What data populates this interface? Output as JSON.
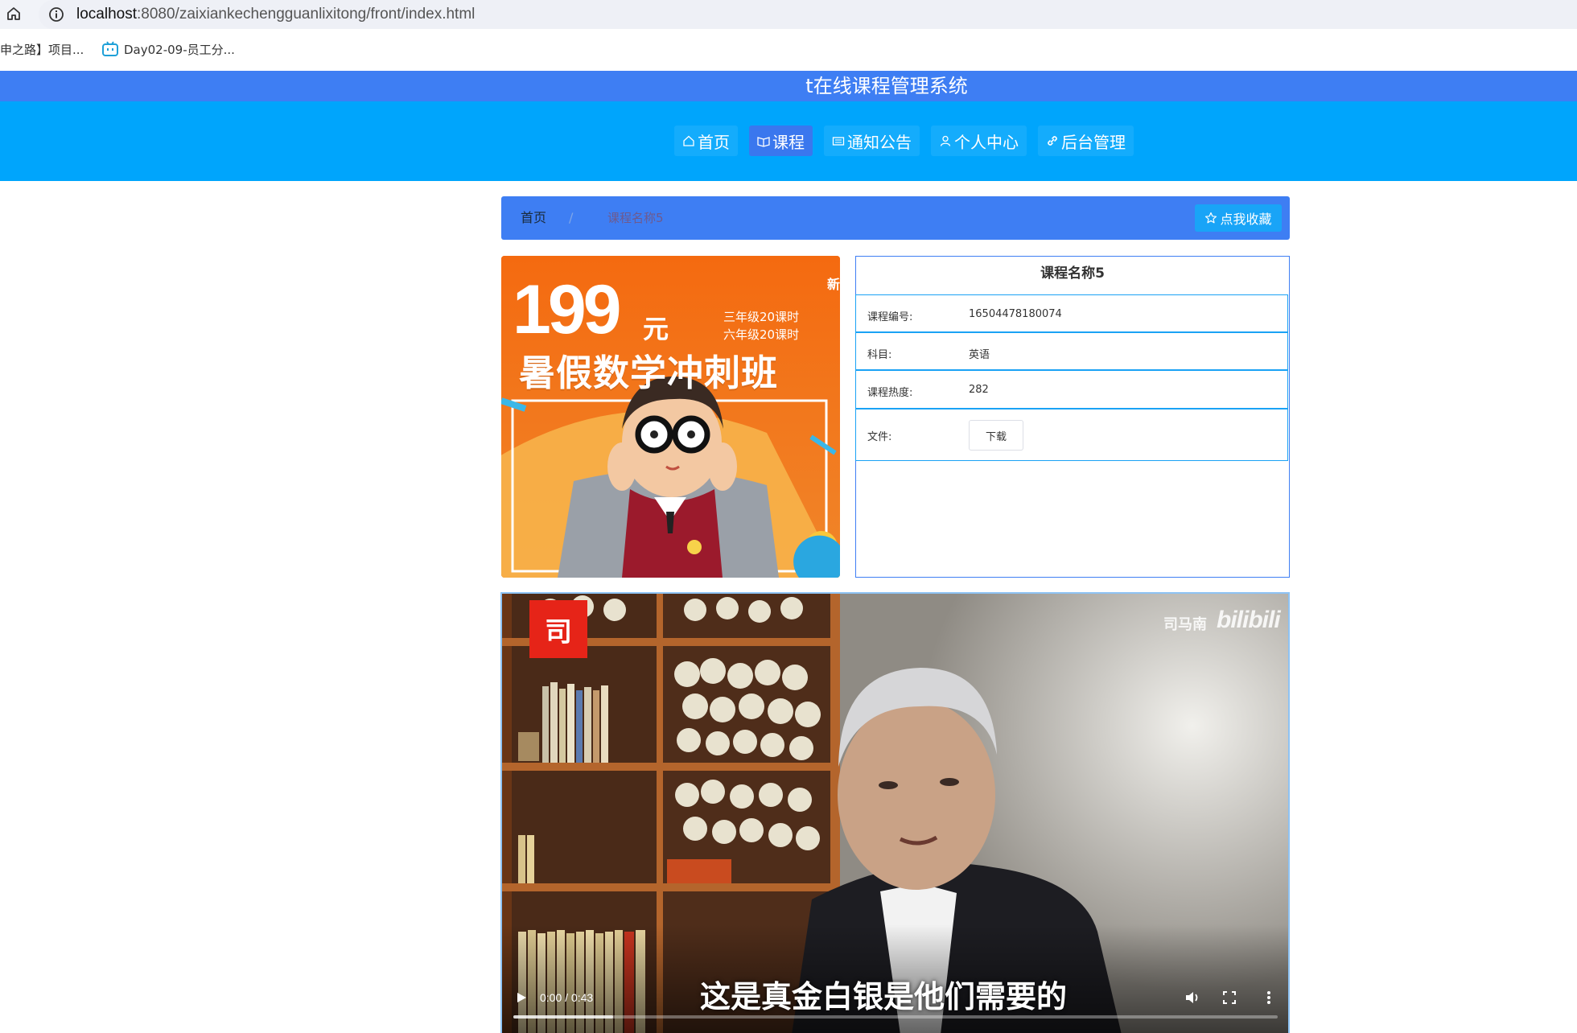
{
  "browser": {
    "url_host": "localhost",
    "url_path": ":8080/zaixiankechengguanlixitong/front/index.html",
    "bookmarks": [
      {
        "label": "申之路】项目..."
      },
      {
        "label": "Day02-09-员工分..."
      }
    ]
  },
  "header": {
    "site_title": "t在线课程管理系统",
    "nav": [
      {
        "label": "首页",
        "icon": "home-icon",
        "active": false
      },
      {
        "label": "课程",
        "icon": "book-icon",
        "active": true
      },
      {
        "label": "通知公告",
        "icon": "news-icon",
        "active": false
      },
      {
        "label": "个人中心",
        "icon": "user-icon",
        "active": false
      },
      {
        "label": "后台管理",
        "icon": "link-icon",
        "active": false
      }
    ]
  },
  "breadcrumb": {
    "home": "首页",
    "separator": "/",
    "current": "课程名称5",
    "favorite_label": "点我收藏"
  },
  "poster": {
    "price": "199",
    "unit": "元",
    "line1": "三年级20课时",
    "line2": "六年级20课时",
    "headline": "暑假数学冲刺班",
    "side_text": "新"
  },
  "course": {
    "title": "课程名称5",
    "rows": [
      {
        "label": "课程编号:",
        "value": "16504478180074"
      },
      {
        "label": "科目:",
        "value": "英语"
      },
      {
        "label": "课程热度:",
        "value": "282"
      }
    ],
    "file_label": "文件:",
    "download_label": "下载"
  },
  "video": {
    "time": "0:00 / 0:43",
    "subtitle": "这是真金白银是他们需要的",
    "watermark_text": "司马南",
    "watermark_logo": "bilibili",
    "badge": "司",
    "progress_buffered": 0.13
  },
  "colors": {
    "title_bar": "#3e7ef3",
    "nav_band": "#00a5fc",
    "active_nav": "#3a77ee",
    "row_border": "#1aa2f5"
  }
}
